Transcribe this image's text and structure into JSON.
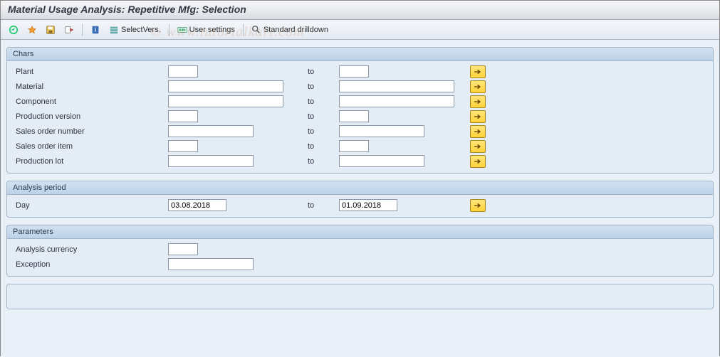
{
  "title": "Material Usage Analysis: Repetitive Mfg: Selection",
  "watermark": "© www.tutorialkart.com",
  "toolbar": {
    "select_vers": "SelectVers.",
    "user_settings": "User settings",
    "standard_drilldown": "Standard drilldown"
  },
  "to_label": "to",
  "groups": {
    "chars": {
      "title": "Chars",
      "rows": [
        {
          "key": "plant",
          "label": "Plant",
          "size": "small",
          "from": "",
          "to_val": ""
        },
        {
          "key": "material",
          "label": "Material",
          "size": "large",
          "from": "",
          "to_val": ""
        },
        {
          "key": "component",
          "label": "Component",
          "size": "large",
          "from": "",
          "to_val": ""
        },
        {
          "key": "production_version",
          "label": "Production version",
          "size": "small",
          "from": "",
          "to_val": ""
        },
        {
          "key": "sales_order_number",
          "label": "Sales order number",
          "size": "medium",
          "from": "",
          "to_val": ""
        },
        {
          "key": "sales_order_item",
          "label": "Sales order item",
          "size": "small",
          "from": "",
          "to_val": ""
        },
        {
          "key": "production_lot",
          "label": "Production lot",
          "size": "medium",
          "from": "",
          "to_val": ""
        }
      ]
    },
    "analysis_period": {
      "title": "Analysis period",
      "day_label": "Day",
      "day_from": "03.08.2018",
      "day_to": "01.09.2018"
    },
    "parameters": {
      "title": "Parameters",
      "analysis_currency_label": "Analysis currency",
      "analysis_currency_value": "",
      "exception_label": "Exception",
      "exception_value": ""
    }
  }
}
